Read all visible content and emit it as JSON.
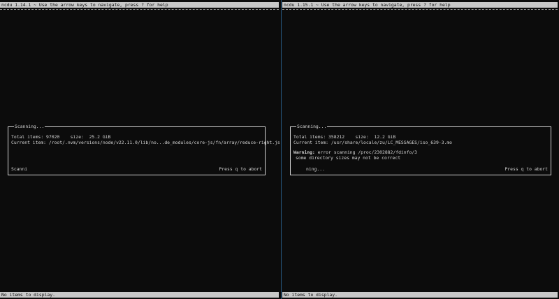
{
  "left": {
    "title": "ncdu 1.14.1 ~ Use the arrow keys to navigate, press ? for help",
    "dialog_title": "Scanning...",
    "total_items_label": "Total items:",
    "total_items_value": "97020",
    "size_label": "size:",
    "size_value": "25.2 GiB",
    "current_item_label": "Current item:",
    "current_item_value": "/root/.nvm/versions/node/v22.11.0/lib/no...de_modules/core-js/fn/array/reduce-right.js",
    "spinner": "Scanni",
    "abort_hint": "Press q to abort",
    "status": "No items to display."
  },
  "right": {
    "title": "ncdu 1.15.1 ~ Use the arrow keys to navigate, press ? for help",
    "dialog_title": "Scanning...",
    "total_items_label": "Total items:",
    "total_items_value": "358212",
    "size_label": "size:",
    "size_value": "12.2 GiB",
    "current_item_label": "Current item:",
    "current_item_value": "/usr/share/locale/zu/LC_MESSAGES/iso_639-3.mo",
    "warning_label": "Warning:",
    "warning_text": "error scanning /proc/2302882/fdinfo/3",
    "warning_note": "some directory sizes may not be correct",
    "spinner": "ning...",
    "abort_hint": "Press q to abort",
    "status": "No items to display."
  }
}
